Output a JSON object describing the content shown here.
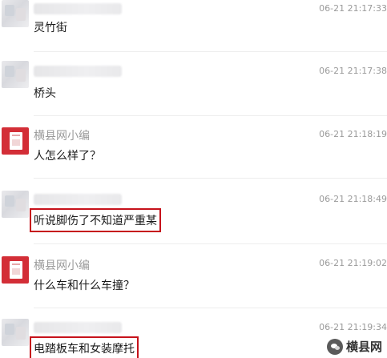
{
  "messages": [
    {
      "author": "",
      "time": "06-21 21:17:33",
      "text": "灵竹街",
      "highlight": false,
      "avatar": "blurred-user-avatar"
    },
    {
      "author": "",
      "time": "06-21 21:17:38",
      "text": "桥头",
      "highlight": false,
      "avatar": "blurred-user-avatar"
    },
    {
      "author": "横县网小编",
      "time": "06-21 21:18:19",
      "text": "人怎么样了？",
      "highlight": false,
      "avatar": "editor-avatar"
    },
    {
      "author": "",
      "time": "06-21 21:18:49",
      "text": "听说脚伤了不知道严重某",
      "highlight": true,
      "avatar": "blurred-user-avatar"
    },
    {
      "author": "横县网小编",
      "time": "06-21 21:19:02",
      "text": "什么车和什么车撞？",
      "highlight": false,
      "avatar": "editor-avatar"
    },
    {
      "author": "",
      "time": "06-21 21:19:34",
      "text": "电踏板车和女装摩托",
      "highlight": true,
      "avatar": "blurred-user-avatar"
    }
  ],
  "watermark": {
    "text": "横县网",
    "icon": "wechat-icon"
  },
  "colors": {
    "highlight_border": "#c6121b",
    "editor_avatar_bg": "#d32e37",
    "meta_text": "#9a9a9a"
  }
}
